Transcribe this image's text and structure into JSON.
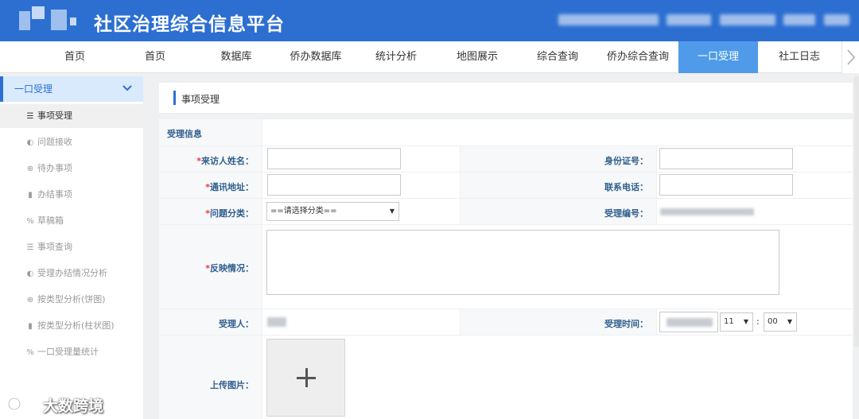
{
  "header": {
    "title": "社区治理综合信息平台"
  },
  "nav": {
    "items": [
      {
        "label": "首页"
      },
      {
        "label": "首页"
      },
      {
        "label": "数据库"
      },
      {
        "label": "侨办数据库"
      },
      {
        "label": "统计分析"
      },
      {
        "label": "地图展示"
      },
      {
        "label": "综合查询"
      },
      {
        "label": "侨办综合查询"
      },
      {
        "label": "一口受理"
      },
      {
        "label": "社工日志"
      }
    ],
    "active_index": 8,
    "more_icon": "chevron-right-icon"
  },
  "sidebar": {
    "header_label": "一口受理",
    "header_icon": "chevron-down-icon",
    "items": [
      {
        "label": "事项受理",
        "icon": "☰"
      },
      {
        "label": "问题接收",
        "icon": "◐"
      },
      {
        "label": "待办事项",
        "icon": "⊕"
      },
      {
        "label": "办结事项",
        "icon": "▮"
      },
      {
        "label": "草稿箱",
        "icon": "%"
      },
      {
        "label": "事项查询",
        "icon": "☰"
      },
      {
        "label": "受理办结情况分析",
        "icon": "◐"
      },
      {
        "label": "按类型分析(饼图)",
        "icon": "⊕"
      },
      {
        "label": "按类型分析(柱状图)",
        "icon": "▮"
      },
      {
        "label": "一口受理量统计",
        "icon": "%"
      }
    ],
    "active_index": 0
  },
  "panel": {
    "title": "事项受理"
  },
  "form": {
    "section_label": "受理信息",
    "visitor_name_label": "来访人姓名：",
    "visitor_name_value": "",
    "id_number_label": "身份证号：",
    "id_number_value": "",
    "address_label": "通讯地址：",
    "address_value": "",
    "phone_label": "联系电话：",
    "phone_value": "",
    "category_label": "问题分类：",
    "category_selected": "==请选择分类==",
    "accept_no_label": "受理编号：",
    "feedback_label": "反映情况：",
    "feedback_value": "",
    "acceptor_label": "受理人：",
    "accept_time_label": "受理时间：",
    "hour_selected": "11",
    "minute_selected": "00",
    "upload_label": "上传图片：",
    "required_mark": "*"
  },
  "watermark": {
    "text": "大数跨境"
  },
  "colors": {
    "brand": "#2c6fd1",
    "active_tab": "#4f9bea",
    "required": "#e33333"
  }
}
